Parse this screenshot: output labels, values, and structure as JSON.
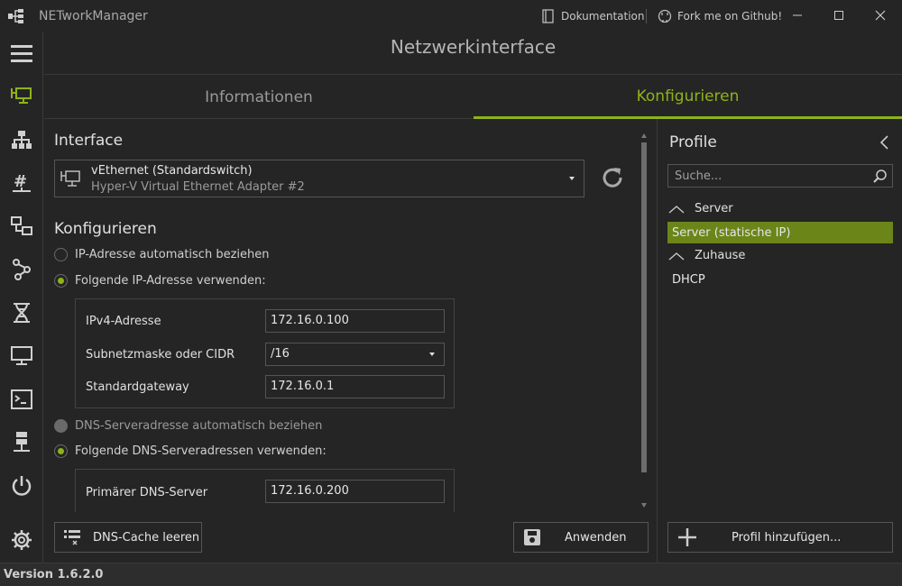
{
  "app": {
    "title": "NETworkManager",
    "version": "Version 1.6.2.0"
  },
  "titlebar": {
    "docs_label": "Dokumentation",
    "github_label": "Fork me on Github!"
  },
  "page": {
    "title": "Netzwerkinterface"
  },
  "tabs": [
    {
      "label": "Informationen",
      "active": false
    },
    {
      "label": "Konfigurieren",
      "active": true
    }
  ],
  "interface": {
    "section_title": "Interface",
    "name": "vEthernet (Standardswitch)",
    "description": "Hyper-V Virtual Ethernet Adapter #2"
  },
  "configure": {
    "section_title": "Konfigurieren",
    "ip_auto_label": "IP-Adresse automatisch beziehen",
    "ip_static_label": "Folgende IP-Adresse verwenden:",
    "ipv4_label": "IPv4-Adresse",
    "ipv4_value": "172.16.0.100",
    "subnet_label": "Subnetzmaske oder CIDR",
    "subnet_value": "/16",
    "gateway_label": "Standardgateway",
    "gateway_value": "172.16.0.1",
    "dns_auto_label": "DNS-Serveradresse automatisch beziehen",
    "dns_static_label": "Folgende DNS-Serveradressen verwenden:",
    "dns_primary_label": "Primärer DNS-Server",
    "dns_primary_value": "172.16.0.200"
  },
  "buttons": {
    "flush_dns": "DNS-Cache leeren",
    "apply": "Anwenden",
    "add_profile": "Profil hinzufügen..."
  },
  "profiles": {
    "title": "Profile",
    "search_placeholder": "Suche...",
    "groups": [
      {
        "name": "Server",
        "items": [
          "Server (statische IP)"
        ]
      },
      {
        "name": "Zuhause",
        "items": [
          "DHCP"
        ]
      }
    ]
  },
  "colors": {
    "accent": "#8fb21b",
    "selected": "#6b8519",
    "background": "#252525"
  },
  "icons": [
    "app-logo-icon",
    "book-icon",
    "github-icon",
    "minimize-icon",
    "maximize-icon",
    "close-icon",
    "hamburger-icon",
    "network-interface-icon",
    "ip-scanner-icon",
    "subnet-calculator-icon",
    "lookup-icon",
    "traceroute-icon",
    "dns-icon",
    "remote-desktop-icon",
    "powershell-icon",
    "server-icon",
    "power-icon",
    "settings-icon",
    "reload-icon",
    "broom-icon",
    "save-icon",
    "plus-icon",
    "search-icon",
    "chevron-left-icon",
    "chevron-up-icon"
  ]
}
